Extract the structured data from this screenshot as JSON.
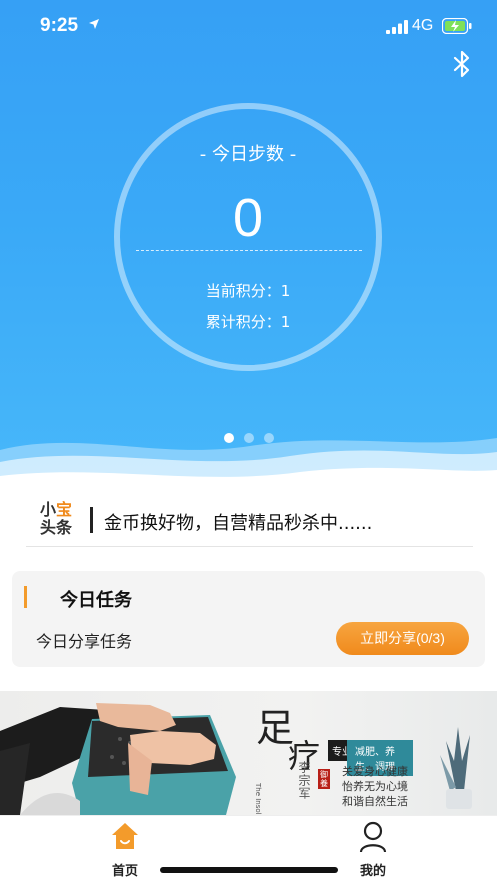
{
  "status_bar": {
    "time": "9:25",
    "network": "4G",
    "icons": [
      "location-arrow-icon",
      "signal-icon",
      "battery-charging-icon"
    ]
  },
  "hero": {
    "title": "- 今日步数 -",
    "step_count": "0",
    "current_points": "当前积分：1",
    "total_points": "累计积分：1",
    "carousel_dots": 3,
    "active_dot": 0,
    "bluetooth_icon": "bluetooth-icon",
    "colors": {
      "gradient_top": "#36a0f5",
      "gradient_bottom": "#48b8fa"
    }
  },
  "news": {
    "logo": [
      "小",
      "宝",
      "头",
      "条"
    ],
    "headline": "金币换好物，自营精品秒杀中......",
    "logo_accent": "#f08a1c"
  },
  "task": {
    "title": "今日任务",
    "item_name": "今日分享任务",
    "button_label": "立即分享(0/3)",
    "accent": "#f39b2b"
  },
  "banner": {
    "title1": "足",
    "title2": "疗",
    "english": "The Insole Health",
    "author": "李宗军",
    "seal": "御養",
    "tag_dark": "专业",
    "tag_teal": "减肥、养生、调理",
    "line1": "关爱身心健康",
    "line2": "怡养无为心境",
    "line3": "和谐自然生活"
  },
  "tabbar": {
    "home": {
      "label": "首页",
      "icon": "home-icon",
      "color": "#f39b2b"
    },
    "mine": {
      "label": "我的",
      "icon": "user-icon"
    }
  }
}
